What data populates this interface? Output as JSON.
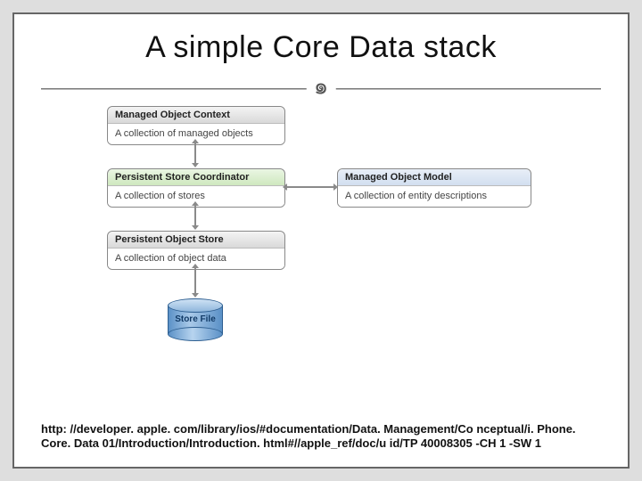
{
  "title": "A simple Core Data stack",
  "flourish_glyph": "་",
  "diagram": {
    "moc": {
      "header": "Managed Object Context",
      "body": "A collection of managed objects"
    },
    "psc": {
      "header": "Persistent Store Coordinator",
      "body": "A collection of stores"
    },
    "mom": {
      "header": "Managed Object Model",
      "body": "A collection of entity descriptions"
    },
    "pos": {
      "header": "Persistent Object Store",
      "body": "A collection of object data"
    },
    "store": {
      "label": "Store\nFile"
    }
  },
  "link": "http: //developer. apple. com/library/ios/#documentation/Data. Management/Co nceptual/i. Phone. Core. Data 01/Introduction/Introduction. html#//apple_ref/doc/u id/TP 40008305 -CH 1 -SW 1"
}
